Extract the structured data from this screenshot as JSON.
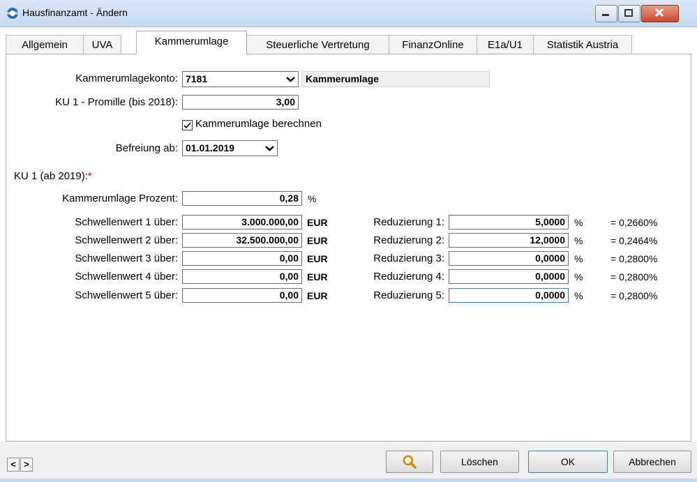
{
  "window": {
    "title": "Hausfinanzamt - Ändern"
  },
  "tabs": [
    {
      "label": "Allgemein"
    },
    {
      "label": "UVA"
    },
    {
      "label": "Kammerumlage"
    },
    {
      "label": "Steuerliche Vertretung"
    },
    {
      "label": "FinanzOnline"
    },
    {
      "label": "E1a/U1"
    },
    {
      "label": "Statistik Austria"
    }
  ],
  "form": {
    "konto_label": "Kammerumlagekonto:",
    "konto_value": "7181",
    "konto_name": "Kammerumlage",
    "promille_label": "KU 1 - Promille (bis 2018):",
    "promille_value": "3,00",
    "checkbox_label": "Kammerumlage berechnen",
    "befreiung_label": "Befreiung ab:",
    "befreiung_value": "01.01.2019",
    "ku1_heading": "KU 1 (ab 2019):",
    "required_mark": "*",
    "prozent_label": "Kammerumlage Prozent:",
    "prozent_value": "0,28",
    "prozent_unit": "%",
    "rows": [
      {
        "label": "Schwellenwert 1 über:",
        "value": "3.000.000,00",
        "unit": "EUR",
        "red_label": "Reduzierung 1:",
        "red_value": "5,0000",
        "pct": "%",
        "result": "= 0,2660%"
      },
      {
        "label": "Schwellenwert 2 über:",
        "value": "32.500.000,00",
        "unit": "EUR",
        "red_label": "Reduzierung 2:",
        "red_value": "12,0000",
        "pct": "%",
        "result": "= 0,2464%"
      },
      {
        "label": "Schwellenwert 3 über:",
        "value": "0,00",
        "unit": "EUR",
        "red_label": "Reduzierung 3:",
        "red_value": "0,0000",
        "pct": "%",
        "result": "= 0,2800%"
      },
      {
        "label": "Schwellenwert 4 über:",
        "value": "0,00",
        "unit": "EUR",
        "red_label": "Reduzierung 4:",
        "red_value": "0,0000",
        "pct": "%",
        "result": "= 0,2800%"
      },
      {
        "label": "Schwellenwert 5 über:",
        "value": "0,00",
        "unit": "EUR",
        "red_label": "Reduzierung 5:",
        "red_value": "0,0000",
        "pct": "%",
        "result": "= 0,2800%"
      }
    ]
  },
  "buttons": {
    "search_icon": "magnifier-icon",
    "delete": "Löschen",
    "ok": "OK",
    "cancel": "Abbrechen",
    "prev": "<",
    "next": ">"
  },
  "colors": {
    "required": "#e00000",
    "titlebar": "#c5d9f0",
    "close": "#c94a2e"
  }
}
